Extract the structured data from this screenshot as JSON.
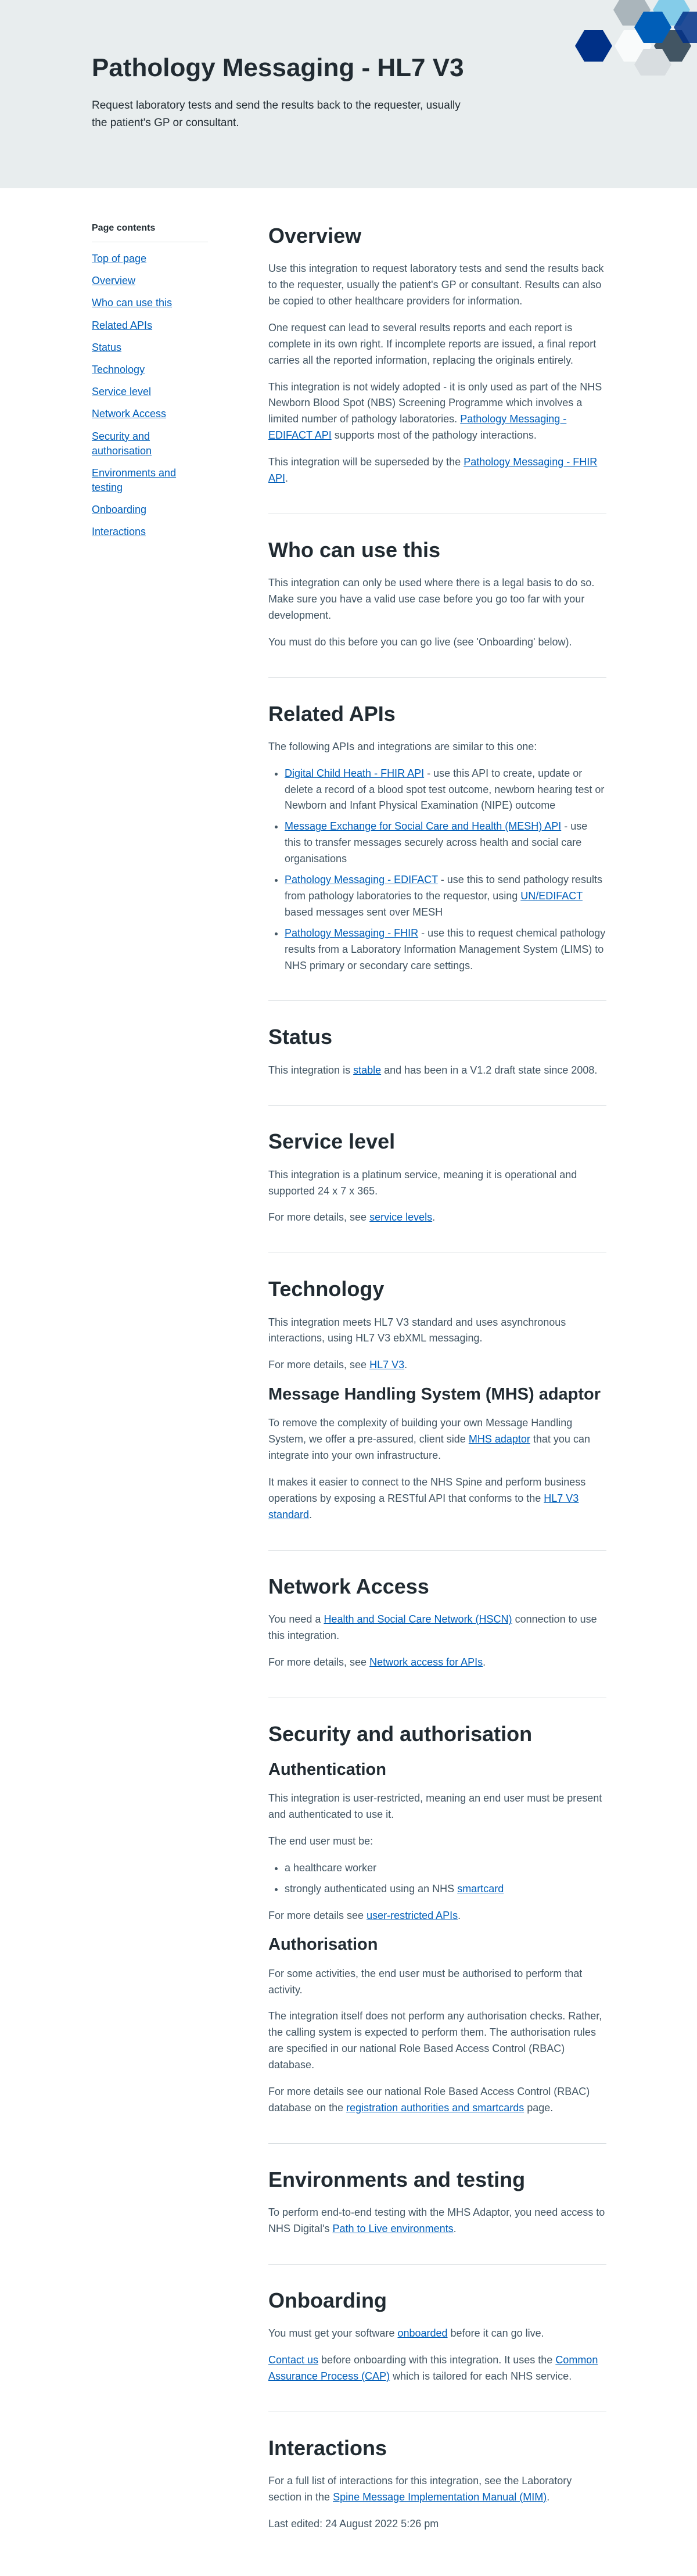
{
  "hero": {
    "title": "Pathology Messaging - HL7 V3",
    "summary": "Request laboratory tests and send the results back to the requester, usually the patient's GP or consultant.",
    "colors": {
      "background": "#e8edee",
      "hex_dark": "#003087",
      "hex_blue": "#005eb8",
      "hex_grey": "#768692"
    }
  },
  "sidebar": {
    "heading": "Page contents",
    "items": [
      "Top of page",
      "Overview",
      "Who can use this",
      "Related APIs",
      "Status",
      "Technology",
      "Service level",
      "Network Access",
      "Security and authorisation",
      "Environments and testing",
      "Onboarding",
      "Interactions"
    ]
  },
  "overview": {
    "heading": "Overview",
    "p1": "Use this integration to request laboratory tests and send the results back to the requester, usually the patient's GP or consultant. Results can also be copied to other healthcare providers for information.",
    "p2": "One request can lead to several results reports and each report is complete in its own right. If incomplete reports are issued, a final report carries all the reported information, replacing the originals entirely.",
    "p3_pre": "This integration is not widely adopted - it is only used as part of the NHS Newborn Blood Spot (NBS) Screening Programme which involves a limited number of pathology laboratories. ",
    "p3_link": "Pathology Messaging - EDIFACT API",
    "p3_post": " supports most of the pathology interactions.",
    "p4_pre": "This integration will be superseded by the ",
    "p4_link": "Pathology Messaging - FHIR API",
    "p4_post": "."
  },
  "who": {
    "heading": "Who can use this",
    "p1": "This integration can only be used where there is a legal basis to do so. Make sure you have a valid use case before you go too far with your development.",
    "p2": "You must do this before you can go live (see 'Onboarding' below)."
  },
  "related": {
    "heading": "Related APIs",
    "intro": "The following APIs and integrations are similar to this one:",
    "items": [
      {
        "link": "Digital Child Heath - FHIR API",
        "text": " - use this API to create, update or delete a record of a blood spot test outcome, newborn hearing test or Newborn and Infant Physical Examination (NIPE) outcome"
      },
      {
        "link": "Message Exchange for Social Care and Health (MESH) API",
        "text": " - use this to transfer messages securely across health and social care organisations"
      },
      {
        "link": "Pathology Messaging - EDIFACT",
        "text": " - use this to send pathology results from pathology laboratories to the requestor, using ",
        "link2": "UN/EDIFACT",
        "text2": " based messages sent over MESH"
      },
      {
        "link": "Pathology Messaging - FHIR",
        "text": " - use this to request chemical pathology results from a Laboratory Information Management System (LIMS) to NHS primary or secondary care settings."
      }
    ]
  },
  "status": {
    "heading": "Status",
    "pre": "This integration is ",
    "link": "stable",
    "post": " and has been in a V1.2 draft state since 2008."
  },
  "service_level": {
    "heading": "Service level",
    "p1": "This integration is a platinum service, meaning it is operational and supported 24 x 7 x 365.",
    "p2_pre": "For more details, see ",
    "p2_link": "service levels",
    "p2_post": "."
  },
  "technology": {
    "heading": "Technology",
    "p1": "This integration meets HL7 V3 standard and uses asynchronous interactions, using HL7 V3 ebXML messaging.",
    "p2_pre": "For more details, see ",
    "p2_link": "HL7 V3",
    "p2_post": ".",
    "mhs_heading": "Message Handling System (MHS) adaptor",
    "mhs_p1_pre": "To remove the complexity of building your own Message Handling System, we offer a pre-assured, client side ",
    "mhs_p1_link": "MHS adaptor",
    "mhs_p1_post": " that you can integrate into your own infrastructure.",
    "mhs_p2_pre": "It makes it easier to connect to the NHS Spine and perform business operations by exposing a RESTful API that conforms to the ",
    "mhs_p2_link": "HL7 V3 standard",
    "mhs_p2_post": "."
  },
  "network": {
    "heading": "Network Access",
    "p1_pre": "You need a ",
    "p1_link": "Health and Social Care Network (HSCN)",
    "p1_post": " connection to use this integration.",
    "p2_pre": "For more details, see ",
    "p2_link": "Network access for APIs",
    "p2_post": "."
  },
  "security": {
    "heading": "Security and authorisation",
    "authn_heading": "Authentication",
    "authn_p1": "This integration is user-restricted, meaning an end user must be present and authenticated to use it.",
    "authn_p2": "The end user must be:",
    "authn_list_1": "a healthcare worker",
    "authn_list_2_pre": "strongly authenticated using an NHS ",
    "authn_list_2_link": "smartcard",
    "authn_p3_pre": "For more details see ",
    "authn_p3_link": "user-restricted APIs",
    "authn_p3_post": ".",
    "authz_heading": "Authorisation",
    "authz_p1": "For some activities, the end user must be authorised to perform that activity.",
    "authz_p2": "The integration itself does not perform any authorisation checks. Rather, the calling system is expected to perform them. The authorisation rules are specified in our national Role Based Access Control (RBAC) database.",
    "authz_p3_pre": "For more details see our national Role Based Access Control (RBAC) database on the ",
    "authz_p3_link": "registration authorities and smartcards",
    "authz_p3_post": " page."
  },
  "environments": {
    "heading": "Environments and testing",
    "p1_pre": "To perform end-to-end testing with the MHS Adaptor, you need access to NHS Digital's ",
    "p1_link": "Path to Live environments",
    "p1_post": "."
  },
  "onboarding": {
    "heading": "Onboarding",
    "p1_pre": "You must get your software ",
    "p1_link": "onboarded",
    "p1_post": " before it can go live.",
    "p2_link1": "Contact us",
    "p2_mid": " before onboarding with this integration. It uses the ",
    "p2_link2": "Common Assurance Process (CAP)",
    "p2_post": " which is tailored for each NHS service."
  },
  "interactions": {
    "heading": "Interactions",
    "p1_pre": "For a full list of interactions for this integration, see the Laboratory section in the ",
    "p1_link": "Spine Message Implementation Manual (MIM)",
    "p1_post": ".",
    "last_edited": "Last edited: 24 August 2022 5:26 pm"
  }
}
